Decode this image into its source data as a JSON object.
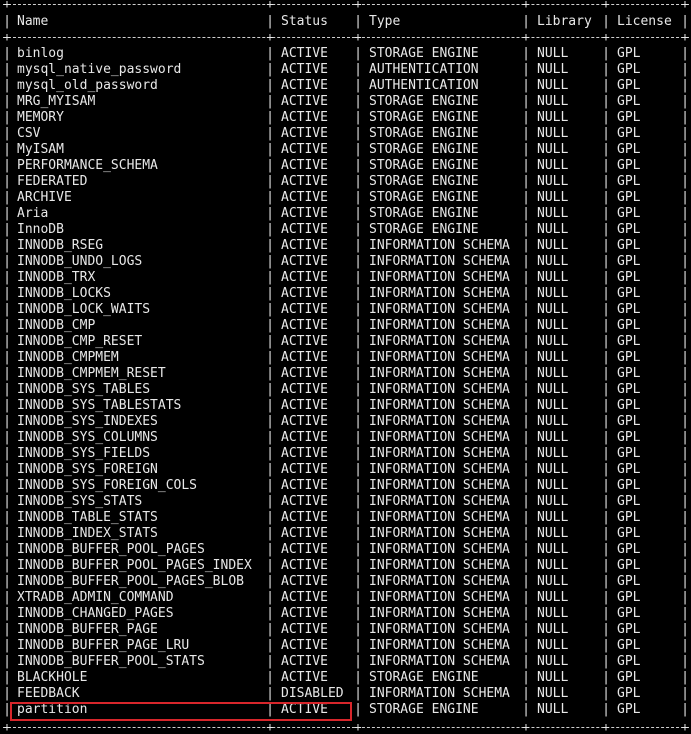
{
  "table": {
    "columns": [
      "Name",
      "Status",
      "Type",
      "Library",
      "License"
    ],
    "rows": [
      [
        "binlog",
        "ACTIVE",
        "STORAGE ENGINE",
        "NULL",
        "GPL"
      ],
      [
        "mysql_native_password",
        "ACTIVE",
        "AUTHENTICATION",
        "NULL",
        "GPL"
      ],
      [
        "mysql_old_password",
        "ACTIVE",
        "AUTHENTICATION",
        "NULL",
        "GPL"
      ],
      [
        "MRG_MYISAM",
        "ACTIVE",
        "STORAGE ENGINE",
        "NULL",
        "GPL"
      ],
      [
        "MEMORY",
        "ACTIVE",
        "STORAGE ENGINE",
        "NULL",
        "GPL"
      ],
      [
        "CSV",
        "ACTIVE",
        "STORAGE ENGINE",
        "NULL",
        "GPL"
      ],
      [
        "MyISAM",
        "ACTIVE",
        "STORAGE ENGINE",
        "NULL",
        "GPL"
      ],
      [
        "PERFORMANCE_SCHEMA",
        "ACTIVE",
        "STORAGE ENGINE",
        "NULL",
        "GPL"
      ],
      [
        "FEDERATED",
        "ACTIVE",
        "STORAGE ENGINE",
        "NULL",
        "GPL"
      ],
      [
        "ARCHIVE",
        "ACTIVE",
        "STORAGE ENGINE",
        "NULL",
        "GPL"
      ],
      [
        "Aria",
        "ACTIVE",
        "STORAGE ENGINE",
        "NULL",
        "GPL"
      ],
      [
        "InnoDB",
        "ACTIVE",
        "STORAGE ENGINE",
        "NULL",
        "GPL"
      ],
      [
        "INNODB_RSEG",
        "ACTIVE",
        "INFORMATION SCHEMA",
        "NULL",
        "GPL"
      ],
      [
        "INNODB_UNDO_LOGS",
        "ACTIVE",
        "INFORMATION SCHEMA",
        "NULL",
        "GPL"
      ],
      [
        "INNODB_TRX",
        "ACTIVE",
        "INFORMATION SCHEMA",
        "NULL",
        "GPL"
      ],
      [
        "INNODB_LOCKS",
        "ACTIVE",
        "INFORMATION SCHEMA",
        "NULL",
        "GPL"
      ],
      [
        "INNODB_LOCK_WAITS",
        "ACTIVE",
        "INFORMATION SCHEMA",
        "NULL",
        "GPL"
      ],
      [
        "INNODB_CMP",
        "ACTIVE",
        "INFORMATION SCHEMA",
        "NULL",
        "GPL"
      ],
      [
        "INNODB_CMP_RESET",
        "ACTIVE",
        "INFORMATION SCHEMA",
        "NULL",
        "GPL"
      ],
      [
        "INNODB_CMPMEM",
        "ACTIVE",
        "INFORMATION SCHEMA",
        "NULL",
        "GPL"
      ],
      [
        "INNODB_CMPMEM_RESET",
        "ACTIVE",
        "INFORMATION SCHEMA",
        "NULL",
        "GPL"
      ],
      [
        "INNODB_SYS_TABLES",
        "ACTIVE",
        "INFORMATION SCHEMA",
        "NULL",
        "GPL"
      ],
      [
        "INNODB_SYS_TABLESTATS",
        "ACTIVE",
        "INFORMATION SCHEMA",
        "NULL",
        "GPL"
      ],
      [
        "INNODB_SYS_INDEXES",
        "ACTIVE",
        "INFORMATION SCHEMA",
        "NULL",
        "GPL"
      ],
      [
        "INNODB_SYS_COLUMNS",
        "ACTIVE",
        "INFORMATION SCHEMA",
        "NULL",
        "GPL"
      ],
      [
        "INNODB_SYS_FIELDS",
        "ACTIVE",
        "INFORMATION SCHEMA",
        "NULL",
        "GPL"
      ],
      [
        "INNODB_SYS_FOREIGN",
        "ACTIVE",
        "INFORMATION SCHEMA",
        "NULL",
        "GPL"
      ],
      [
        "INNODB_SYS_FOREIGN_COLS",
        "ACTIVE",
        "INFORMATION SCHEMA",
        "NULL",
        "GPL"
      ],
      [
        "INNODB_SYS_STATS",
        "ACTIVE",
        "INFORMATION SCHEMA",
        "NULL",
        "GPL"
      ],
      [
        "INNODB_TABLE_STATS",
        "ACTIVE",
        "INFORMATION SCHEMA",
        "NULL",
        "GPL"
      ],
      [
        "INNODB_INDEX_STATS",
        "ACTIVE",
        "INFORMATION SCHEMA",
        "NULL",
        "GPL"
      ],
      [
        "INNODB_BUFFER_POOL_PAGES",
        "ACTIVE",
        "INFORMATION SCHEMA",
        "NULL",
        "GPL"
      ],
      [
        "INNODB_BUFFER_POOL_PAGES_INDEX",
        "ACTIVE",
        "INFORMATION SCHEMA",
        "NULL",
        "GPL"
      ],
      [
        "INNODB_BUFFER_POOL_PAGES_BLOB",
        "ACTIVE",
        "INFORMATION SCHEMA",
        "NULL",
        "GPL"
      ],
      [
        "XTRADB_ADMIN_COMMAND",
        "ACTIVE",
        "INFORMATION SCHEMA",
        "NULL",
        "GPL"
      ],
      [
        "INNODB_CHANGED_PAGES",
        "ACTIVE",
        "INFORMATION SCHEMA",
        "NULL",
        "GPL"
      ],
      [
        "INNODB_BUFFER_PAGE",
        "ACTIVE",
        "INFORMATION SCHEMA",
        "NULL",
        "GPL"
      ],
      [
        "INNODB_BUFFER_PAGE_LRU",
        "ACTIVE",
        "INFORMATION SCHEMA",
        "NULL",
        "GPL"
      ],
      [
        "INNODB_BUFFER_POOL_STATS",
        "ACTIVE",
        "INFORMATION SCHEMA",
        "NULL",
        "GPL"
      ],
      [
        "BLACKHOLE",
        "ACTIVE",
        "STORAGE ENGINE",
        "NULL",
        "GPL"
      ],
      [
        "FEEDBACK",
        "DISABLED",
        "INFORMATION SCHEMA",
        "NULL",
        "GPL"
      ],
      [
        "partition",
        "ACTIVE",
        "STORAGE ENGINE",
        "NULL",
        "GPL"
      ]
    ],
    "highlighted_row_index": 41
  },
  "colors": {
    "background": "#000000",
    "text": "#e8e8e8",
    "border": "#cfcfcf",
    "highlight": "#d8262b"
  }
}
